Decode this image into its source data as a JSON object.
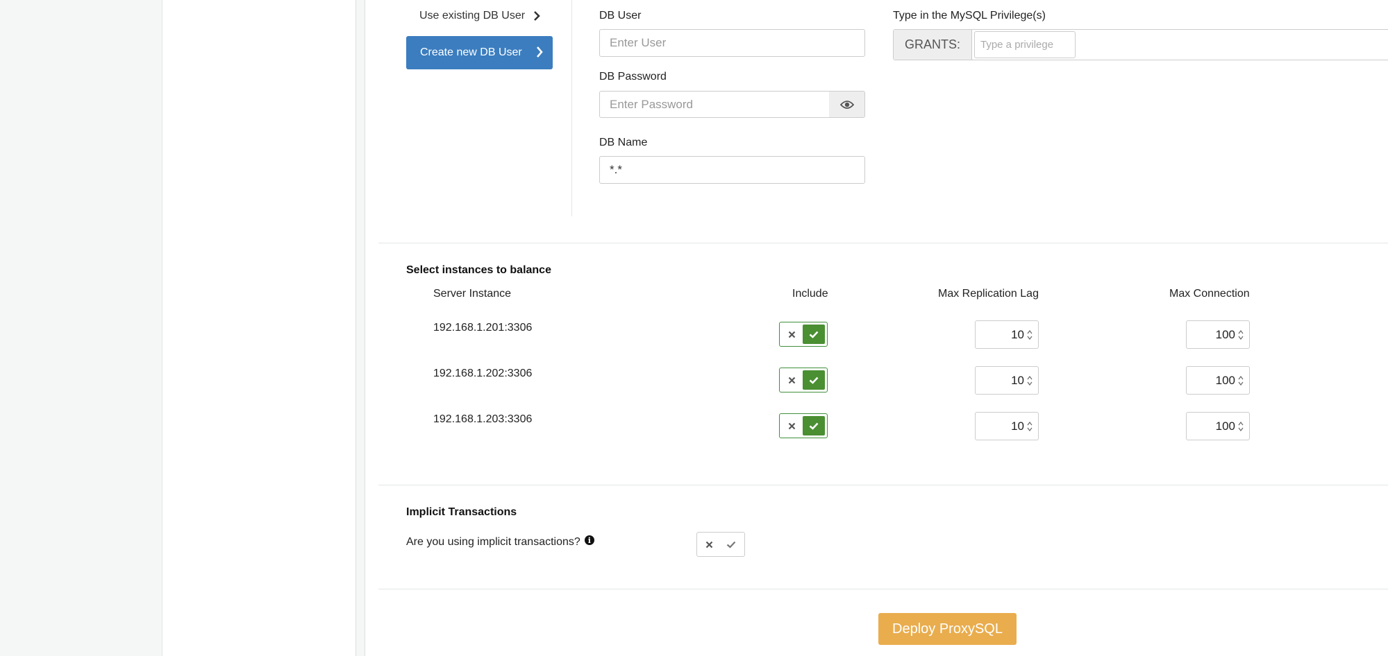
{
  "user_type": {
    "use_existing_label": "Use existing DB User",
    "create_new_label": "Create new DB User"
  },
  "db_user": {
    "label": "DB User",
    "placeholder": "Enter User"
  },
  "db_password": {
    "label": "DB Password",
    "placeholder": "Enter Password"
  },
  "db_name": {
    "label": "DB Name",
    "value": "*.*"
  },
  "privileges": {
    "label": "Type in the MySQL Privilege(s)",
    "addon": "GRANTS:",
    "placeholder": "Type a privilege"
  },
  "instances": {
    "title": "Select instances to balance",
    "headers": {
      "server": "Server Instance",
      "include": "Include",
      "lag": "Max Replication Lag",
      "conn": "Max Connection"
    },
    "rows": [
      {
        "server": "192.168.1.201:3306",
        "include": true,
        "lag": "10",
        "conn": "100"
      },
      {
        "server": "192.168.1.202:3306",
        "include": true,
        "lag": "10",
        "conn": "100"
      },
      {
        "server": "192.168.1.203:3306",
        "include": true,
        "lag": "10",
        "conn": "100"
      }
    ]
  },
  "implicit": {
    "title": "Implicit Transactions",
    "question": "Are you using implicit transactions?",
    "enabled": false
  },
  "deploy_label": "Deploy ProxySQL",
  "colors": {
    "primary": "#3b7dbf",
    "success": "#4a8f32",
    "warning": "#e9ad4e"
  }
}
